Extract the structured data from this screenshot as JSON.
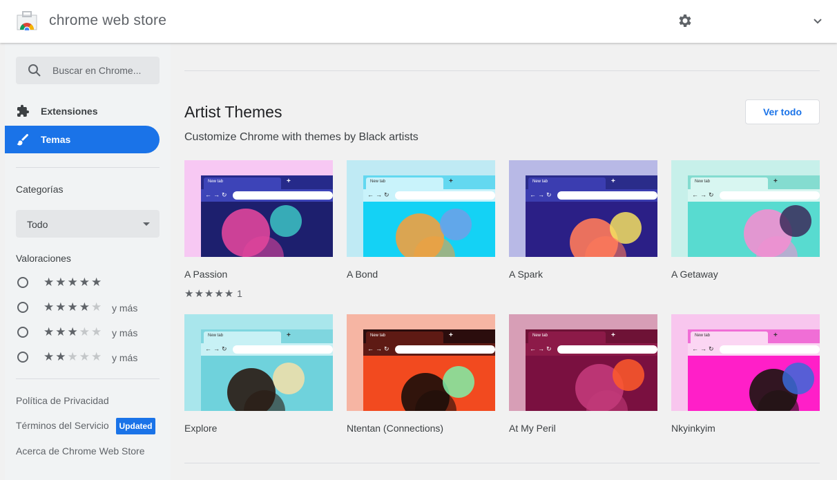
{
  "header": {
    "title": "chrome web store",
    "logo_icon": "chrome-web-store-logo",
    "settings_icon": "gear-icon",
    "account_icon": "chevron-down-icon"
  },
  "sidebar": {
    "search": {
      "placeholder": "Buscar en Chrome..."
    },
    "nav": [
      {
        "label": "Extensiones",
        "icon": "puzzle-icon",
        "active": false
      },
      {
        "label": "Temas",
        "icon": "brush-icon",
        "active": true
      }
    ],
    "categories": {
      "title": "Categorías",
      "selected": "Todo"
    },
    "ratings": {
      "title": "Valoraciones",
      "options": [
        {
          "stars": 5,
          "suffix": ""
        },
        {
          "stars": 4,
          "suffix": "y más"
        },
        {
          "stars": 3,
          "suffix": "y más"
        },
        {
          "stars": 2,
          "suffix": "y más"
        }
      ]
    },
    "footer": {
      "privacy": "Política de Privacidad",
      "terms": "Términos del Servicio",
      "terms_badge": "Updated",
      "about": "Acerca de Chrome Web Store"
    }
  },
  "main": {
    "section": {
      "title": "Artist Themes",
      "subtitle": "Customize Chrome with themes by Black artists",
      "view_all": "Ver todo"
    },
    "tab_label": "New tab",
    "themes": [
      {
        "title": "A Passion",
        "rating_stars": "★★★★★",
        "rating_count": "1",
        "colors": {
          "bg": "#f7c8f3",
          "frame": "#262a8a",
          "tab": "#3d44b8",
          "toolbar": "#3d44b8",
          "content": "#1d1f6e",
          "accent": "#e0459b",
          "accent2": "#3cc4c4"
        }
      },
      {
        "title": "A Bond",
        "colors": {
          "bg": "#bfeaf4",
          "frame": "#63d8f0",
          "tab": "#c9f3fb",
          "toolbar": "#c9f3fb",
          "content": "#14d2f5",
          "accent": "#f0a040",
          "accent2": "#6fa0e8"
        }
      },
      {
        "title": "A Spark",
        "colors": {
          "bg": "#b8b9e6",
          "frame": "#2a2c8a",
          "tab": "#3b3db0",
          "toolbar": "#3b3db0",
          "content": "#2b1f86",
          "accent": "#ff7a5a",
          "accent2": "#f4e060"
        }
      },
      {
        "title": "A Getaway",
        "colors": {
          "bg": "#c7f0ea",
          "frame": "#84dcd0",
          "tab": "#d8f6f1",
          "toolbar": "#d8f6f1",
          "content": "#58dbd0",
          "accent": "#f28fd0",
          "accent2": "#3b2a5a"
        }
      },
      {
        "title": "Explore",
        "colors": {
          "bg": "#a9e6ec",
          "frame": "#7fd6df",
          "tab": "#c8f1f5",
          "toolbar": "#c8f1f5",
          "content": "#6fd2dc",
          "accent": "#2a1a12",
          "accent2": "#f6e0a8"
        }
      },
      {
        "title": "Ntentan (Connections)",
        "colors": {
          "bg": "#f6b5a3",
          "frame": "#2b0d0d",
          "tab": "#5e1a14",
          "toolbar": "#5e1a14",
          "content": "#f24a1f",
          "accent": "#1c0e0a",
          "accent2": "#7ff0a8"
        }
      },
      {
        "title": "At My Peril",
        "colors": {
          "bg": "#d79eb6",
          "frame": "#6e1236",
          "tab": "#8c1a48",
          "toolbar": "#8c1a48",
          "content": "#7a1040",
          "accent": "#c23a7a",
          "accent2": "#ff5a2a"
        }
      },
      {
        "title": "Nkyinkyim",
        "colors": {
          "bg": "#f8c6ee",
          "frame": "#f06ed6",
          "tab": "#fbd6f3",
          "toolbar": "#fbd6f3",
          "content": "#ff1fc8",
          "accent": "#1c1410",
          "accent2": "#3a6ad8"
        }
      }
    ]
  },
  "colors": {
    "accent": "#1a73e8",
    "sidebar_bg": "#f1f3f4",
    "page_bg": "#f1f1f1"
  }
}
